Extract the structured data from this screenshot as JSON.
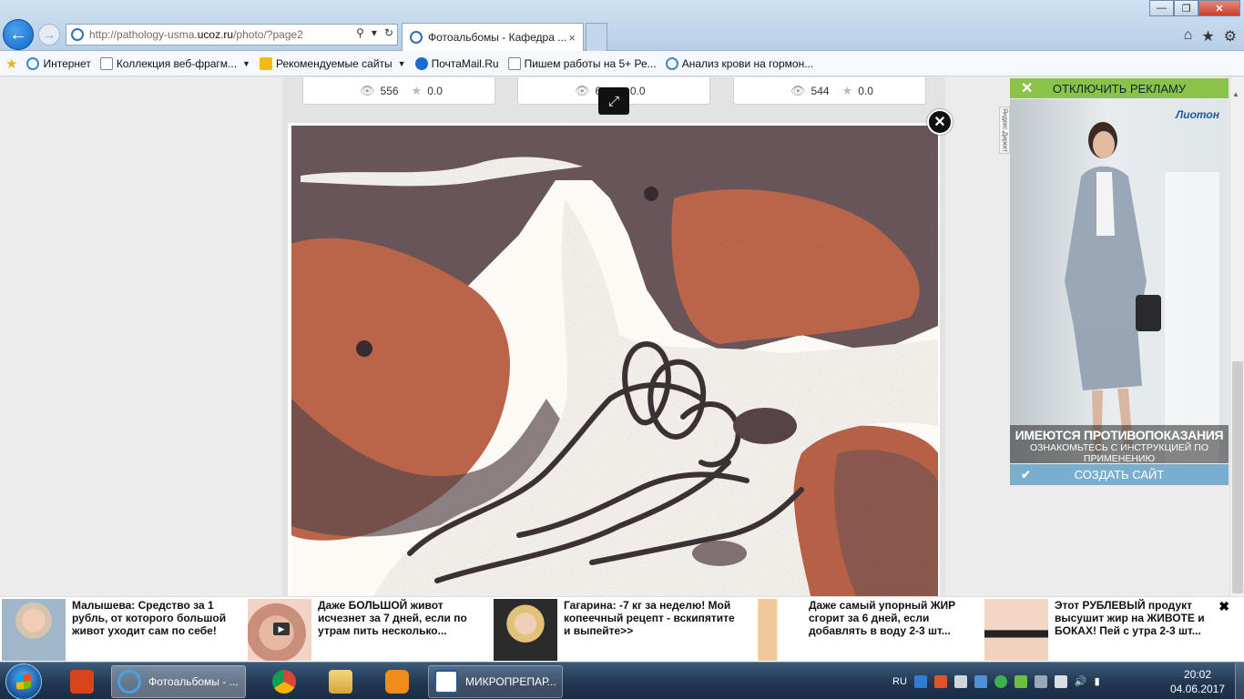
{
  "browser": {
    "url_prefix": "http://pathology-usma.",
    "url_domain": "ucoz.ru",
    "url_suffix": "/photo/?page2",
    "tab_title": "Фотоальбомы - Кафедра ...",
    "tab_close": "×",
    "window_controls": {
      "minimize": "—",
      "maximize": "❐",
      "close": "✕"
    },
    "tools_icons": [
      "home-icon",
      "star-icon",
      "gear-icon"
    ]
  },
  "favorites": [
    {
      "label": "Интернет",
      "icon": "ie-icon",
      "dropdown": false
    },
    {
      "label": "Коллекция веб-фрагм...",
      "icon": "page-icon",
      "dropdown": true
    },
    {
      "label": "Рекомендуемые сайты",
      "icon": "bing-icon",
      "dropdown": true
    },
    {
      "label": "ПочтаMail.Ru",
      "icon": "mail-icon",
      "dropdown": false
    },
    {
      "label": "Пишем работы на 5+  Ре...",
      "icon": "page-icon",
      "dropdown": false
    },
    {
      "label": "Анализ крови на гормон...",
      "icon": "ie-icon",
      "dropdown": false
    }
  ],
  "thumbnails": [
    {
      "views": "556",
      "rating": "0.0"
    },
    {
      "views": "6",
      "rating": "0.0"
    },
    {
      "views": "544",
      "rating": "0.0"
    }
  ],
  "lightbox": {
    "fullscreen_icon": "⤢",
    "close_icon": "✕"
  },
  "side_ad": {
    "disable_label": "Отключить рекламу",
    "disable_icon": "✕",
    "brand": "Лиотон",
    "label_vertical": "Яндекс.Директ",
    "caption_line1": "ИМЕЮТСЯ ПРОТИВОПОКАЗАНИЯ",
    "caption_line2": "ОЗНАКОМЬТЕСЬ С ИНСТРУКЦИЕЙ ПО ПРИМЕНЕНИЮ",
    "create_label": "Создать сайт",
    "create_icon": "✔"
  },
  "news": [
    {
      "text": "Малышева: Средство за 1 рубль, от которого большой живот уходит сам по себе!"
    },
    {
      "text": "Даже БОЛЬШОЙ живот исчезнет за 7 дней, если по утрам пить несколько..."
    },
    {
      "text": "Гагарина: -7 кг за неделю! Мой копеечный рецепт - вскипятите и выпейте>>"
    },
    {
      "text": "Даже самый упорный ЖИР сгорит за 6 дней, если добавлять в воду 2-3 шт..."
    },
    {
      "text": "Этот РУБЛЕВЫЙ продукт высушит жир на ЖИВОТЕ и БОКАХ! Пей с утра 2-3 шт..."
    }
  ],
  "news_close": "✖",
  "taskbar": {
    "ie_label": "Фотоальбомы - ...",
    "word_label": "МИКРОПРЕПАР...",
    "lang": "RU",
    "time": "20:02",
    "date": "04.06.2017"
  },
  "colors": {
    "accent_green": "#8bc34a",
    "accent_blue": "#7aaecf",
    "tissue_red": "#c8664a",
    "tissue_dark": "#5a4a52"
  }
}
